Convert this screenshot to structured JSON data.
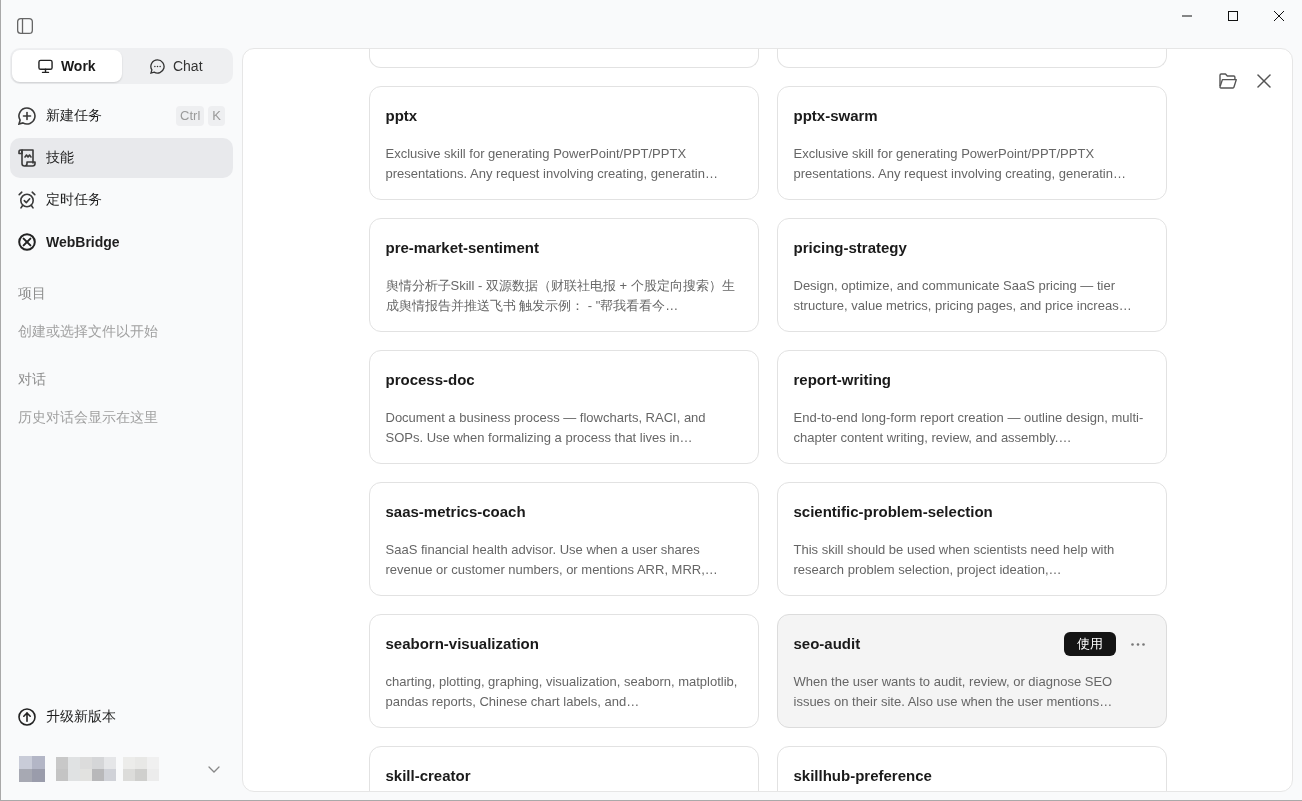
{
  "sidebar": {
    "modes": [
      {
        "label": "Work",
        "selected": true
      },
      {
        "label": "Chat",
        "selected": false
      }
    ],
    "nav": [
      {
        "label": "新建任务",
        "kind": "page",
        "selected": false,
        "shortcut": [
          "Ctrl",
          "K"
        ]
      },
      {
        "label": "技能",
        "kind": "page",
        "selected": true
      },
      {
        "label": "定时任务",
        "kind": "page",
        "selected": false
      },
      {
        "label": "WebBridge",
        "kind": "integration",
        "selected": false
      }
    ],
    "sections": [
      {
        "heading": "项目",
        "empty_text": "创建或选择文件以开始"
      },
      {
        "heading": "对话",
        "empty_text": "历史对话会显示在这里"
      }
    ],
    "upgrade": {
      "label": "升级新版本"
    },
    "account": {
      "expanded": false
    }
  },
  "skills": {
    "cards": [
      {
        "kind": "cut-off"
      },
      {
        "kind": "cut-off"
      },
      {
        "kind": "full",
        "title": "pptx",
        "description": "Exclusive skill for generating PowerPoint/PPT/PPTX presentations. Any request involving creating, generatin…",
        "highlighted": false
      },
      {
        "kind": "full",
        "title": "pptx-swarm",
        "description": "Exclusive skill for generating PowerPoint/PPT/PPTX presentations. Any request involving creating, generatin…",
        "highlighted": false
      },
      {
        "kind": "full",
        "title": "pre-market-sentiment",
        "description": "舆情分析子Skill - 双源数据（财联社电报 + 个股定向搜索）生成舆情报告并推送飞书 触发示例： - \"帮我看看今…",
        "highlighted": false
      },
      {
        "kind": "full",
        "title": "pricing-strategy",
        "description": "Design, optimize, and communicate SaaS pricing — tier structure, value metrics, pricing pages, and price increas…",
        "highlighted": false
      },
      {
        "kind": "full",
        "title": "process-doc",
        "description": "Document a business process — flowcharts, RACI, and SOPs. Use when formalizing a process that lives in…",
        "highlighted": false
      },
      {
        "kind": "full",
        "title": "report-writing",
        "description": "End-to-end long-form report creation — outline design, multi-chapter content writing, review, and assembly.…",
        "highlighted": false
      },
      {
        "kind": "full",
        "title": "saas-metrics-coach",
        "description": "SaaS financial health advisor. Use when a user shares revenue or customer numbers, or mentions ARR, MRR,…",
        "highlighted": false
      },
      {
        "kind": "full",
        "title": "scientific-problem-selection",
        "description": "This skill should be used when scientists need help with research problem selection, project ideation,…",
        "highlighted": false
      },
      {
        "kind": "full",
        "title": "seaborn-visualization",
        "description": "charting, plotting, graphing, visualization, seaborn, matplotlib, pandas reports, Chinese chart labels, and…",
        "highlighted": false
      },
      {
        "kind": "full",
        "title": "seo-audit",
        "description": "When the user wants to audit, review, or diagnose SEO issues on their site. Also use when the user mentions…",
        "highlighted": true,
        "action_button": "使用"
      },
      {
        "kind": "full",
        "title": "skill-creator",
        "highlighted": false
      },
      {
        "kind": "full",
        "title": "skillhub-preference",
        "highlighted": false
      }
    ]
  }
}
